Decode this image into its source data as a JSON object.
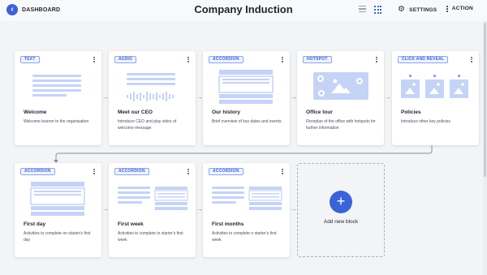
{
  "header": {
    "back_icon": "chevron-left-icon",
    "back_label": "DASHBOARD",
    "title": "Company Induction",
    "settings_label": "SETTINGS",
    "action_label": "ACTION",
    "active_view": "grid"
  },
  "colors": {
    "accent": "#3b63d8",
    "illustration": "#c5d3f6",
    "badge_bg": "#eef2fd"
  },
  "blocks": [
    {
      "type": "TEXT",
      "title": "Welcome",
      "desc": "Welcome learner to the organisation",
      "illustration": "text-lines"
    },
    {
      "type": "AUDIO",
      "title": "Meet our CEO",
      "desc": "Introduce CEO and play video of welcome message",
      "illustration": "audio-wave"
    },
    {
      "type": "ACCORDION",
      "title": "Our history",
      "desc": "Brief overview of key dates and events",
      "illustration": "accordion-panel"
    },
    {
      "type": "HOTSPOT",
      "title": "Office tour",
      "desc": "Floorplan of the office with hotspots for further information",
      "illustration": "hotspot-image"
    },
    {
      "type": "CLICK AND REVEAL",
      "title": "Policies",
      "desc": "Introduce other key policies",
      "illustration": "reveal-tiles"
    },
    {
      "type": "ACCORDION",
      "title": "First day",
      "desc": "Activities to complete on starter's first day",
      "illustration": "accordion-panel"
    },
    {
      "type": "ACCORDION",
      "title": "First week",
      "desc": "Activities to complete in starter's first week",
      "illustration": "accordion-split"
    },
    {
      "type": "ACCORDION",
      "title": "First months",
      "desc": "Activities to complete n starter's first week",
      "illustration": "accordion-split"
    }
  ],
  "add_block": {
    "label": "Add new block",
    "icon": "plus-icon"
  }
}
